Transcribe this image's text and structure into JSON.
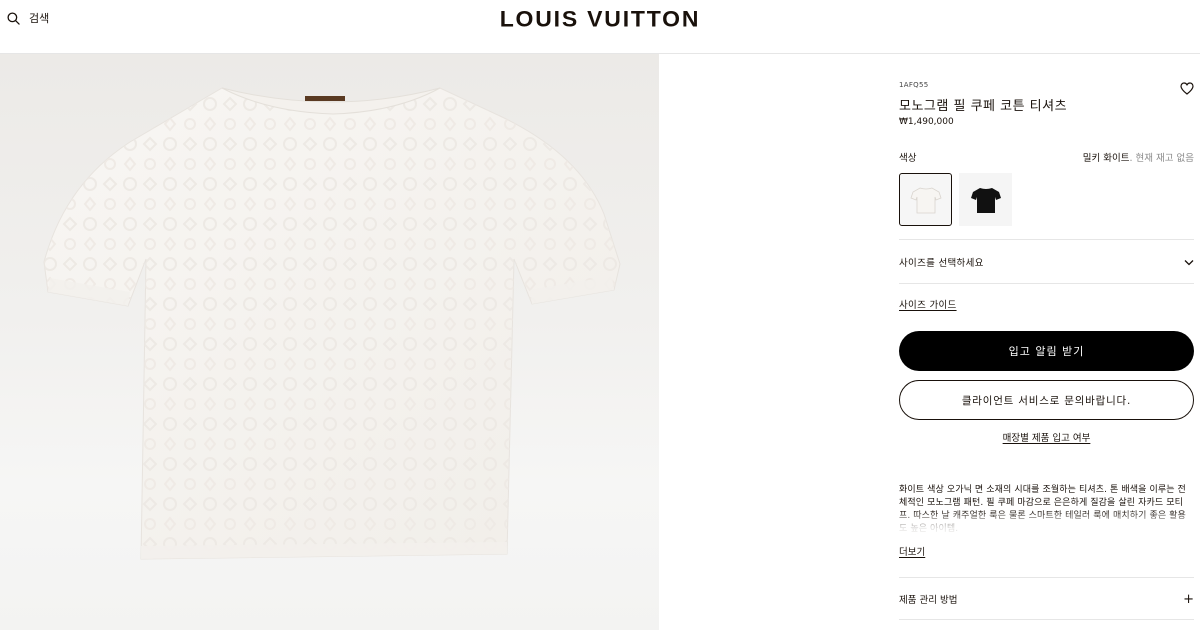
{
  "header": {
    "search_label": "검색",
    "brand": "LOUIS VUITTON"
  },
  "product": {
    "sku": "1AFQ55",
    "name": "모노그램 필 쿠페 코튼 티셔츠",
    "price": "₩1,490,000",
    "color_label": "색상",
    "color_value": "밀키 화이트",
    "stock_status": ". 현재 재고 없음",
    "swatches": [
      {
        "name": "white tee swatch",
        "color": "#f7f5f2",
        "selected": true
      },
      {
        "name": "black tee swatch",
        "color": "#111111",
        "selected": false
      }
    ]
  },
  "size": {
    "select_label": "사이즈를 선택하세요",
    "guide_label": "사이즈 가이드"
  },
  "actions": {
    "primary_label": "입고 알림 받기",
    "secondary_label": "클라이언트 서비스로 문의바랍니다.",
    "store_link": "매장별 제품 입고 여부"
  },
  "description": {
    "text": "화이트 색상 오가닉 면 소재의 시대를 조월하는 티셔츠. 톤 배색을 이루는 전체적인 모노그램 패턴. 필 쿠페 마감으로 은은하게 질감을 살린 자카드 모티프. 따스한 날 캐주얼한 룩은 물론 스마트한 테일러 룩에 매치하기 좋은 활용도 높은 아이템.",
    "more_label": "더보기"
  },
  "care": {
    "label": "제품 관리 방법",
    "toggle": "+"
  },
  "colors": {
    "text": "#19110b",
    "button_bg": "#000000",
    "image_bg": "#eeedeb"
  }
}
